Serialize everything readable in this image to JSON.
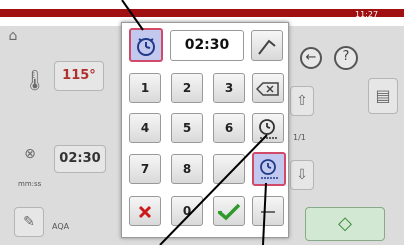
{
  "status_bar": {
    "time": "11:27"
  },
  "background": {
    "temperature_value": "115°",
    "timer_value": "02:30",
    "timer_unit": "mm:ss",
    "probe_label": "AQA",
    "pager_label": "1/1",
    "help_symbol": "?"
  },
  "keypad": {
    "display_value": "02:30",
    "digits": [
      "1",
      "2",
      "3",
      "4",
      "5",
      "6",
      "7",
      "8",
      "0"
    ]
  },
  "icons": {
    "time_mode": "clock-icon",
    "toggle": "arrow-pointer-icon",
    "backspace": "backspace-icon",
    "cancel": "cross-icon",
    "confirm": "checkmark-icon",
    "colors": {
      "accent_red": "#a01010",
      "highlight_border": "#d14a6a",
      "highlight_fill": "#c3c9ee"
    }
  }
}
